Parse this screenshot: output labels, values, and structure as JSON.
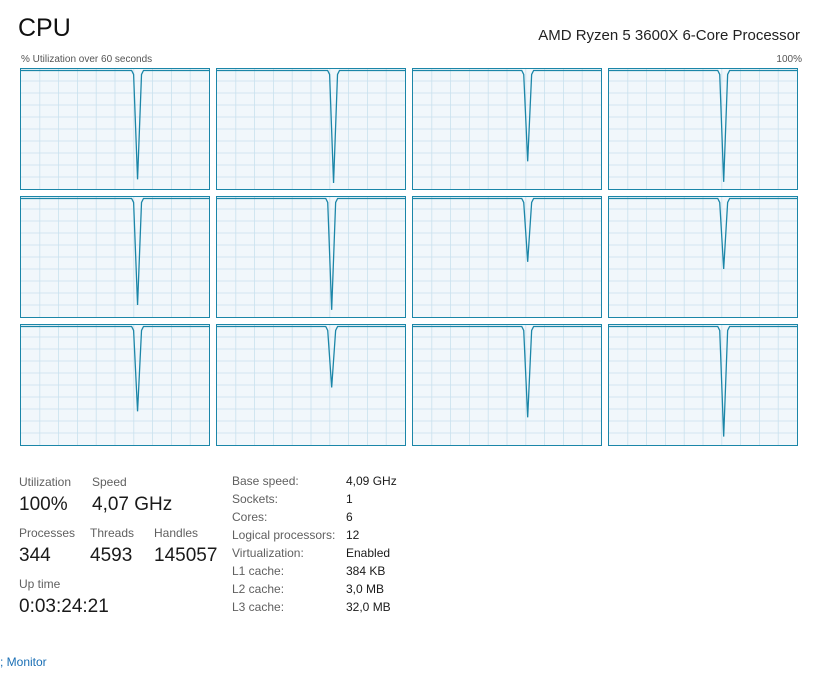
{
  "header": {
    "title": "CPU",
    "processor": "AMD Ryzen 5 3600X 6-Core Processor",
    "axis_label": "% Utilization over 60 seconds",
    "axis_max": "100%"
  },
  "graphs": {
    "count": 12,
    "colors": {
      "line": "#1b86a8",
      "grid": "#c9e1ee",
      "background": "#f1f7fb"
    },
    "dips": [
      {
        "t": 0.62,
        "min": 0.08
      },
      {
        "t": 0.62,
        "min": 0.05
      },
      {
        "t": 0.61,
        "min": 0.23
      },
      {
        "t": 0.61,
        "min": 0.06
      },
      {
        "t": 0.62,
        "min": 0.1
      },
      {
        "t": 0.61,
        "min": 0.06
      },
      {
        "t": 0.61,
        "min": 0.46
      },
      {
        "t": 0.61,
        "min": 0.4
      },
      {
        "t": 0.62,
        "min": 0.28
      },
      {
        "t": 0.61,
        "min": 0.48
      },
      {
        "t": 0.61,
        "min": 0.23
      },
      {
        "t": 0.61,
        "min": 0.07
      }
    ]
  },
  "stats": {
    "utilization": {
      "label": "Utilization",
      "value": "100%"
    },
    "speed": {
      "label": "Speed",
      "value": "4,07 GHz"
    },
    "processes": {
      "label": "Processes",
      "value": "344"
    },
    "threads": {
      "label": "Threads",
      "value": "4593"
    },
    "handles": {
      "label": "Handles",
      "value": "145057"
    },
    "uptime": {
      "label": "Up time",
      "value": "0:03:24:21"
    }
  },
  "info": [
    {
      "key": "Base speed:",
      "value": "4,09 GHz"
    },
    {
      "key": "Sockets:",
      "value": "1"
    },
    {
      "key": "Cores:",
      "value": "6"
    },
    {
      "key": "Logical processors:",
      "value": "12"
    },
    {
      "key": "Virtualization:",
      "value": "Enabled"
    },
    {
      "key": "L1 cache:",
      "value": "384 KB"
    },
    {
      "key": "L2 cache:",
      "value": "3,0 MB"
    },
    {
      "key": "L3 cache:",
      "value": "32,0 MB"
    }
  ],
  "footer": {
    "link": "; Monitor"
  }
}
